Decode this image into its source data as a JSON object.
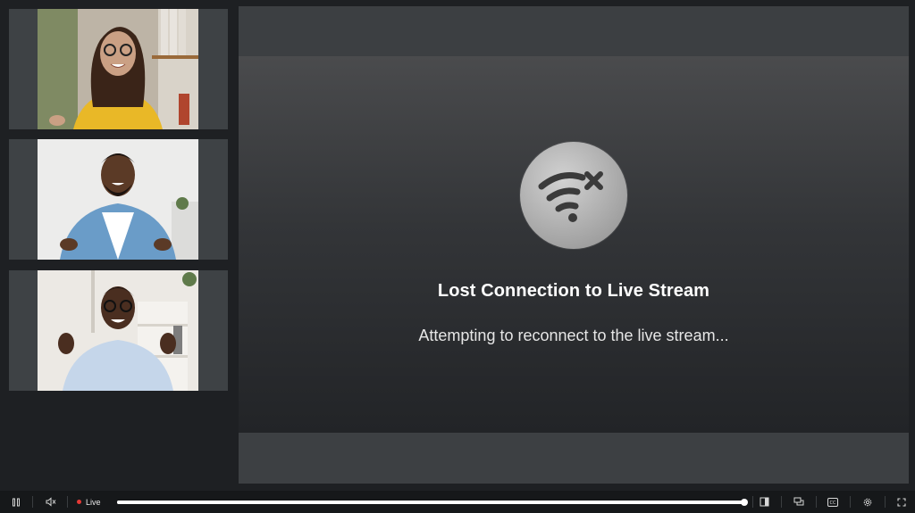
{
  "participants": [
    {
      "name": "participant-1",
      "shirt_color": "#e9b827",
      "bg_color": "#c9c3ba"
    },
    {
      "name": "participant-2",
      "shirt_color": "#6a9cc8",
      "bg_color": "#e7e7e6"
    },
    {
      "name": "participant-3",
      "shirt_color": "#c5d6ea",
      "bg_color": "#ece9e4"
    }
  ],
  "stage": {
    "icon": "wifi-off-icon",
    "title": "Lost Connection to Live Stream",
    "subtitle": "Attempting to reconnect to the live stream..."
  },
  "controls": {
    "play_pause_icon": "pause-icon",
    "volume_icon": "volume-muted-icon",
    "live_label": "Live",
    "live_color": "#e53935",
    "progress": 1.0,
    "right_icons": [
      "sidebar-layout-icon",
      "chat-icon",
      "captions-icon",
      "settings-icon",
      "fullscreen-icon"
    ]
  }
}
